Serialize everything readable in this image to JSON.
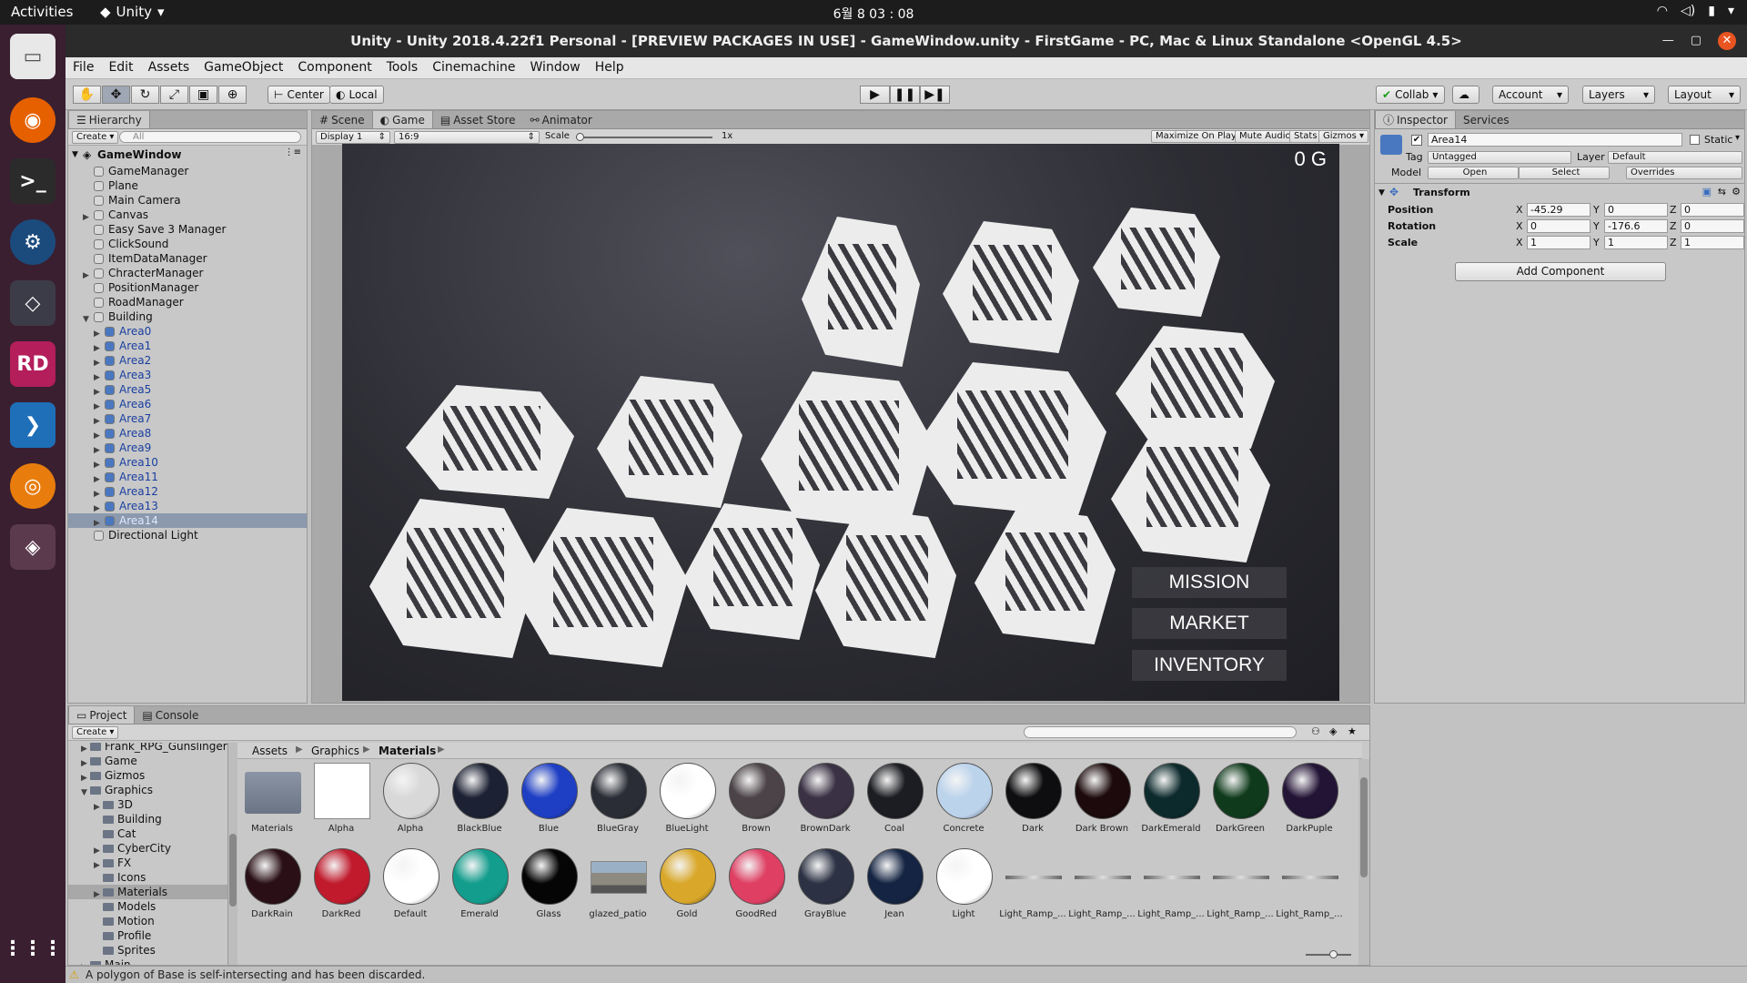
{
  "topbar": {
    "activities": "Activities",
    "app": "Unity",
    "clock": "6월 8 03 : 08"
  },
  "window": {
    "title": "Unity - Unity 2018.4.22f1 Personal - [PREVIEW PACKAGES IN USE] - GameWindow.unity - FirstGame - PC, Mac & Linux Standalone <OpenGL 4.5>"
  },
  "menu": [
    "File",
    "Edit",
    "Assets",
    "GameObject",
    "Component",
    "Tools",
    "Cinemachine",
    "Window",
    "Help"
  ],
  "toolbar": {
    "center": "Center",
    "local": "Local",
    "collab": "Collab",
    "account": "Account",
    "layers": "Layers",
    "layout": "Layout"
  },
  "hierarchy": {
    "tab": "Hierarchy",
    "create": "Create",
    "search": "All",
    "scene": "GameWindow",
    "items": [
      {
        "label": "GameManager",
        "depth": 1,
        "arrow": "",
        "sel": false
      },
      {
        "label": "Plane",
        "depth": 1,
        "arrow": "",
        "sel": false
      },
      {
        "label": "Main Camera",
        "depth": 1,
        "arrow": "",
        "sel": false
      },
      {
        "label": "Canvas",
        "depth": 1,
        "arrow": "▶",
        "sel": false
      },
      {
        "label": "Easy Save 3 Manager",
        "depth": 1,
        "arrow": "",
        "sel": false
      },
      {
        "label": "ClickSound",
        "depth": 1,
        "arrow": "",
        "sel": false
      },
      {
        "label": "ItemDataManager",
        "depth": 1,
        "arrow": "",
        "sel": false
      },
      {
        "label": "ChracterManager",
        "depth": 1,
        "arrow": "▶",
        "sel": false
      },
      {
        "label": "PositionManager",
        "depth": 1,
        "arrow": "",
        "sel": false
      },
      {
        "label": "RoadManager",
        "depth": 1,
        "arrow": "",
        "sel": false
      },
      {
        "label": "Building",
        "depth": 1,
        "arrow": "▼",
        "sel": false
      },
      {
        "label": "Area0",
        "depth": 2,
        "arrow": "▶",
        "sel": false
      },
      {
        "label": "Area1",
        "depth": 2,
        "arrow": "▶",
        "sel": false
      },
      {
        "label": "Area2",
        "depth": 2,
        "arrow": "▶",
        "sel": false
      },
      {
        "label": "Area3",
        "depth": 2,
        "arrow": "▶",
        "sel": false
      },
      {
        "label": "Area5",
        "depth": 2,
        "arrow": "▶",
        "sel": false
      },
      {
        "label": "Area6",
        "depth": 2,
        "arrow": "▶",
        "sel": false
      },
      {
        "label": "Area7",
        "depth": 2,
        "arrow": "▶",
        "sel": false
      },
      {
        "label": "Area8",
        "depth": 2,
        "arrow": "▶",
        "sel": false
      },
      {
        "label": "Area9",
        "depth": 2,
        "arrow": "▶",
        "sel": false
      },
      {
        "label": "Area10",
        "depth": 2,
        "arrow": "▶",
        "sel": false
      },
      {
        "label": "Area11",
        "depth": 2,
        "arrow": "▶",
        "sel": false
      },
      {
        "label": "Area12",
        "depth": 2,
        "arrow": "▶",
        "sel": false
      },
      {
        "label": "Area13",
        "depth": 2,
        "arrow": "▶",
        "sel": false
      },
      {
        "label": "Area14",
        "depth": 2,
        "arrow": "▶",
        "sel": true
      },
      {
        "label": "Directional Light",
        "depth": 1,
        "arrow": "",
        "sel": false
      }
    ]
  },
  "sceneTabs": {
    "scene": "Scene",
    "game": "Game",
    "assetstore": "Asset Store",
    "animator": "Animator"
  },
  "gamebar": {
    "display": "Display 1",
    "aspect": "16:9",
    "scale_label": "Scale",
    "scale_value": "1x",
    "maximize": "Maximize On Play",
    "mute": "Mute Audio",
    "stats": "Stats",
    "gizmos": "Gizmos"
  },
  "game": {
    "counter": "0 G",
    "buttons": [
      "MISSION",
      "MARKET",
      "INVENTORY"
    ]
  },
  "inspector": {
    "tab": "Inspector",
    "services": "Services",
    "object": "Area14",
    "static": "Static",
    "tag_label": "Tag",
    "tag": "Untagged",
    "layer_label": "Layer",
    "layer": "Default",
    "model_label": "Model",
    "open": "Open",
    "select": "Select",
    "overrides": "Overrides",
    "transform": "Transform",
    "rows": [
      {
        "label": "Position",
        "x": "-45.29",
        "y": "0",
        "z": "0"
      },
      {
        "label": "Rotation",
        "x": "0",
        "y": "-176.6",
        "z": "0"
      },
      {
        "label": "Scale",
        "x": "1",
        "y": "1",
        "z": "1"
      }
    ],
    "axis": [
      "X",
      "Y",
      "Z"
    ],
    "add": "Add Component"
  },
  "project": {
    "tab": "Project",
    "console": "Console",
    "create": "Create",
    "tree": [
      {
        "label": "Frank_RPG_Gunslinger",
        "arrow": "▶",
        "depth": 1,
        "sel": false
      },
      {
        "label": "Game",
        "arrow": "▶",
        "depth": 1,
        "sel": false
      },
      {
        "label": "Gizmos",
        "arrow": "▶",
        "depth": 1,
        "sel": false
      },
      {
        "label": "Graphics",
        "arrow": "▼",
        "depth": 1,
        "sel": false
      },
      {
        "label": "3D",
        "arrow": "▶",
        "depth": 2,
        "sel": false
      },
      {
        "label": "Building",
        "arrow": "",
        "depth": 2,
        "sel": false
      },
      {
        "label": "Cat",
        "arrow": "",
        "depth": 2,
        "sel": false
      },
      {
        "label": "CyberCity",
        "arrow": "▶",
        "depth": 2,
        "sel": false
      },
      {
        "label": "FX",
        "arrow": "▶",
        "depth": 2,
        "sel": false
      },
      {
        "label": "Icons",
        "arrow": "",
        "depth": 2,
        "sel": false
      },
      {
        "label": "Materials",
        "arrow": "▶",
        "depth": 2,
        "sel": true
      },
      {
        "label": "Models",
        "arrow": "",
        "depth": 2,
        "sel": false
      },
      {
        "label": "Motion",
        "arrow": "",
        "depth": 2,
        "sel": false
      },
      {
        "label": "Profile",
        "arrow": "",
        "depth": 2,
        "sel": false
      },
      {
        "label": "Sprites",
        "arrow": "",
        "depth": 2,
        "sel": false
      },
      {
        "label": "Main",
        "arrow": "▶",
        "depth": 1,
        "sel": false
      }
    ],
    "breadcrumb": [
      "Assets",
      "Graphics",
      "Materials"
    ],
    "assets": [
      {
        "label": "Materials",
        "kind": "folder",
        "color": "#6b7585"
      },
      {
        "label": "Alpha",
        "kind": "square",
        "color": "#ffffff"
      },
      {
        "label": "Alpha",
        "kind": "ball",
        "color": "#d8d8d8"
      },
      {
        "label": "BlackBlue",
        "kind": "ball",
        "color": "#1c2233"
      },
      {
        "label": "Blue",
        "kind": "ball",
        "color": "#1e3fc4"
      },
      {
        "label": "BlueGray",
        "kind": "ball",
        "color": "#2a2d36"
      },
      {
        "label": "BlueLight",
        "kind": "ball",
        "color": "#ffffff"
      },
      {
        "label": "Brown",
        "kind": "ball",
        "color": "#4b4347"
      },
      {
        "label": "BrownDark",
        "kind": "ball",
        "color": "#3a3144"
      },
      {
        "label": "Coal",
        "kind": "ball",
        "color": "#1c1d22"
      },
      {
        "label": "Concrete",
        "kind": "ball",
        "color": "#bcd3ec"
      },
      {
        "label": "Dark",
        "kind": "ball",
        "color": "#0e0e10"
      },
      {
        "label": "Dark Brown",
        "kind": "ball",
        "color": "#1c0a0c"
      },
      {
        "label": "DarkEmerald",
        "kind": "ball",
        "color": "#0c2a2c"
      },
      {
        "label": "DarkGreen",
        "kind": "ball",
        "color": "#0f3b1c"
      },
      {
        "label": "DarkPuple",
        "kind": "ball",
        "color": "#231436"
      },
      {
        "label": "DarkRain",
        "kind": "ball",
        "color": "#2a1016"
      },
      {
        "label": "DarkRed",
        "kind": "ball",
        "color": "#c01a2c"
      },
      {
        "label": "Default",
        "kind": "ball",
        "color": "#ffffff"
      },
      {
        "label": "Emerald",
        "kind": "ball",
        "color": "#139d8c"
      },
      {
        "label": "Glass",
        "kind": "ball",
        "color": "#050505"
      },
      {
        "label": "glazed_patio",
        "kind": "photo",
        "color": "#8d8a80"
      },
      {
        "label": "Gold",
        "kind": "ball",
        "color": "#d9a82a"
      },
      {
        "label": "GoodRed",
        "kind": "ball",
        "color": "#de3f63"
      },
      {
        "label": "GrayBlue",
        "kind": "ball",
        "color": "#2c3244"
      },
      {
        "label": "Jean",
        "kind": "ball",
        "color": "#142442"
      },
      {
        "label": "Light",
        "kind": "ball",
        "color": "#ffffff"
      },
      {
        "label": "Light_Ramp_...",
        "kind": "ramp",
        "color": "#9a9a9a"
      },
      {
        "label": "Light_Ramp_...",
        "kind": "ramp",
        "color": "#9a9a9a"
      },
      {
        "label": "Light_Ramp_...",
        "kind": "ramp",
        "color": "#9a9a9a"
      },
      {
        "label": "Light_Ramp_...",
        "kind": "ramp",
        "color": "#9a9a9a"
      },
      {
        "label": "Light_Ramp_...",
        "kind": "ramp",
        "color": "#9a9a9a"
      }
    ]
  },
  "status": {
    "message": "A polygon of Base is self-intersecting and has been discarded."
  }
}
